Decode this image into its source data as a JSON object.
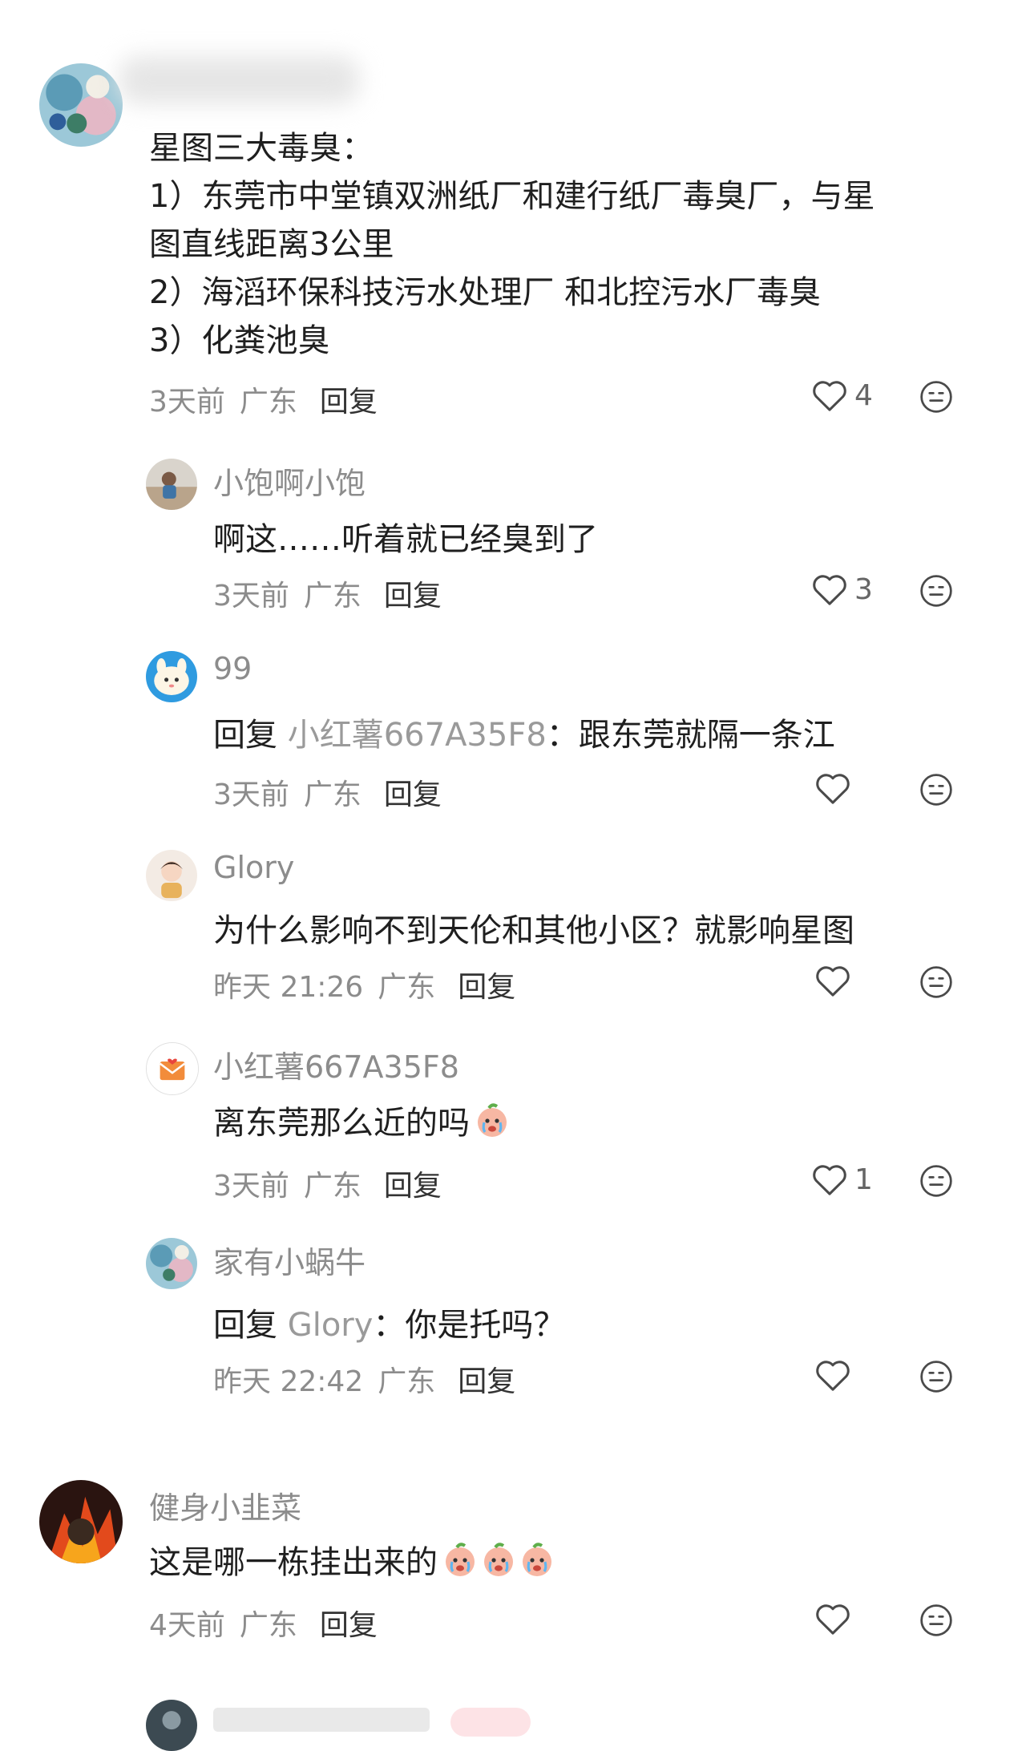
{
  "colors": {
    "name": "#8c8c8c",
    "text": "#1f1f1f",
    "meta": "#8c8c8c",
    "icon": "#4a4a4a"
  },
  "icons": {
    "like": "heart-outline-icon",
    "react": "emoji-face-icon"
  },
  "comments": [
    {
      "name": "",
      "lines": [
        "星图三大毒臭：",
        "1）东莞市中堂镇双洲纸厂和建行纸厂毒臭厂，与星",
        "图直线距离3公里",
        "2）海滔环保科技污水处理厂 和北控污水厂毒臭",
        "3）化粪池臭"
      ],
      "time": "3天前",
      "location": "广东",
      "reply_label": "回复",
      "likes": "4"
    },
    {
      "name": "小饱啊小饱",
      "text": "啊这……听着就已经臭到了",
      "time": "3天前",
      "location": "广东",
      "reply_label": "回复",
      "likes": "3"
    },
    {
      "name": "99",
      "reply_prefix": "回复",
      "reply_target": "小红薯667A35F8",
      "text": "：跟东莞就隔一条江",
      "time": "3天前",
      "location": "广东",
      "reply_label": "回复",
      "likes": ""
    },
    {
      "name": "Glory",
      "text": "为什么影响不到天伦和其他小区？就影响星图",
      "time": "昨天 21:26",
      "location": "广东",
      "reply_label": "回复",
      "likes": ""
    },
    {
      "name": "小红薯667A35F8",
      "text": "离东莞那么近的吗",
      "emoji_count": 1,
      "time": "3天前",
      "location": "广东",
      "reply_label": "回复",
      "likes": "1"
    },
    {
      "name": "家有小蜗牛",
      "reply_prefix": "回复",
      "reply_target": "Glory",
      "text": "：你是托吗？",
      "time": "昨天 22:42",
      "location": "广东",
      "reply_label": "回复",
      "likes": ""
    },
    {
      "name": "健身小韭菜",
      "text": "这是哪一栋挂出来的",
      "emoji_count": 3,
      "time": "4天前",
      "location": "广东",
      "reply_label": "回复",
      "likes": ""
    }
  ]
}
